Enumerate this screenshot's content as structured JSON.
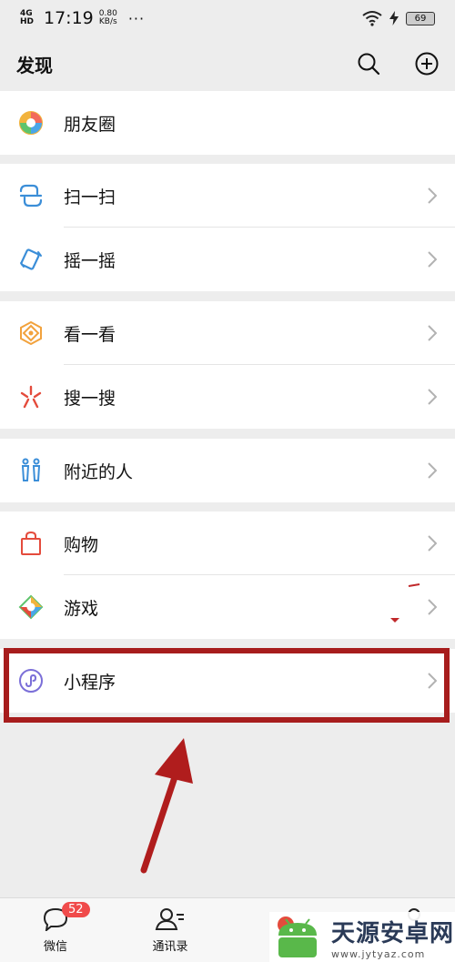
{
  "status_bar": {
    "network": "4G HD",
    "time": "17:19",
    "speed_value": "0.80",
    "speed_unit": "KB/s",
    "more": "···",
    "battery": "69"
  },
  "header": {
    "title": "发现"
  },
  "menu": {
    "moments": "朋友圈",
    "scan": "扫一扫",
    "shake": "摇一摇",
    "top_stories": "看一看",
    "search": "搜一搜",
    "nearby": "附近的人",
    "shopping": "购物",
    "games": "游戏",
    "mini_programs": "小程序"
  },
  "tabs": {
    "chats": "微信",
    "chats_badge": "52",
    "contacts": "通讯录"
  },
  "watermark": {
    "title": "天源安卓网",
    "url": "www.jytyaz.com"
  },
  "colors": {
    "highlight": "#a71d1d",
    "badge": "#f04b4b",
    "arrow": "#b01d1d"
  }
}
